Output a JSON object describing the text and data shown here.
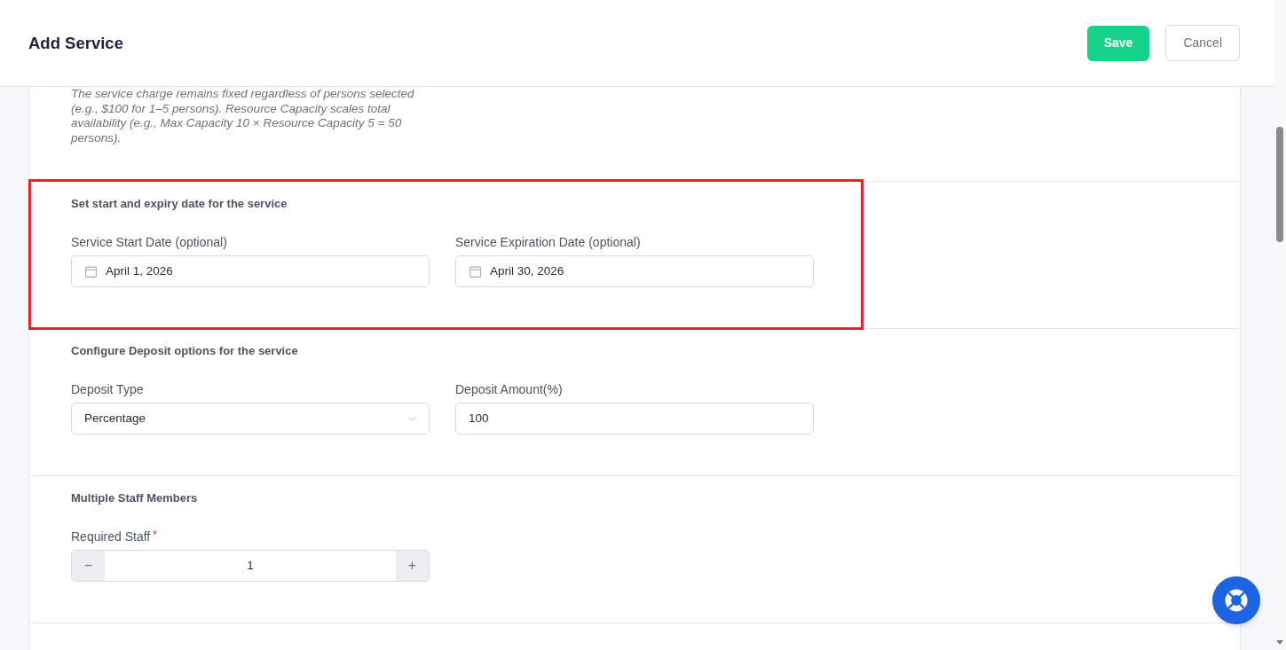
{
  "header": {
    "title": "Add Service",
    "buttons": [
      {
        "label": "Save",
        "kind": "primary"
      },
      {
        "label": "Cancel",
        "kind": "secondary"
      }
    ]
  },
  "pricing_note": {
    "text": "The service charge remains fixed regardless of persons selected (e.g., $100 for 1–5 persons). Resource Capacity scales total availability (e.g., Max Capacity 10 × Resource Capacity 5 = 50 persons)."
  },
  "sections": [
    {
      "title": "Set start and expiry date for the service",
      "highlighted": true,
      "fields": [
        {
          "kind": "date",
          "label": "Service Start Date (optional)",
          "value": "April 1, 2026"
        },
        {
          "kind": "date",
          "label": "Service Expiration Date (optional)",
          "value": "April 30, 2026"
        }
      ]
    },
    {
      "title": "Configure Deposit options for the service",
      "highlighted": false,
      "fields": [
        {
          "kind": "select",
          "label": "Deposit Type",
          "value": "Percentage"
        },
        {
          "kind": "text",
          "label": "Deposit Amount(%)",
          "value": "100"
        }
      ]
    },
    {
      "title": "Multiple Staff Members",
      "highlighted": false,
      "fields": [
        {
          "kind": "stepper",
          "label": "Required Staff",
          "required_mark": "*",
          "value": "1",
          "decrement": "−",
          "increment": "+"
        }
      ]
    }
  ]
}
